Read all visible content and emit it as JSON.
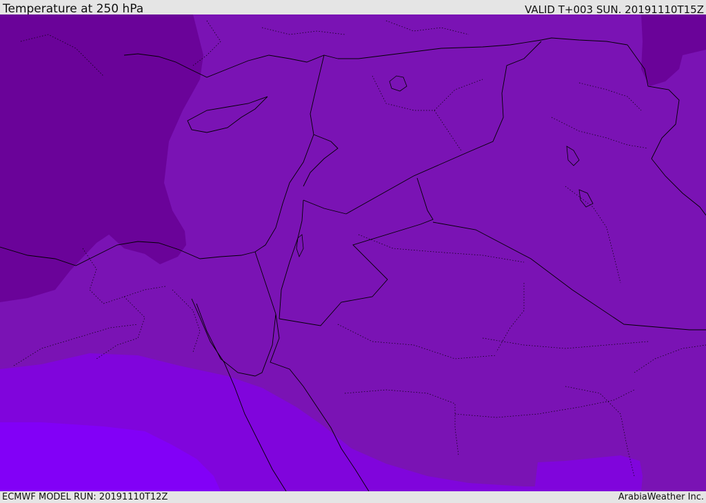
{
  "header": {
    "title": "Temperature at 250 hPa",
    "valid": "VALID T+003 SUN. 20191110T15Z"
  },
  "footer": {
    "model_run": "ECMWF MODEL RUN: 20191110T12Z",
    "credit": "ArabiaWeather Inc."
  },
  "map": {
    "field": "temperature",
    "level": "250 hPa",
    "fill_colors": {
      "coldest": "#6a0399",
      "cold": "#7a13b4",
      "mild": "#8005dc",
      "warm": "#8200f7"
    },
    "border_color": "#000000"
  }
}
